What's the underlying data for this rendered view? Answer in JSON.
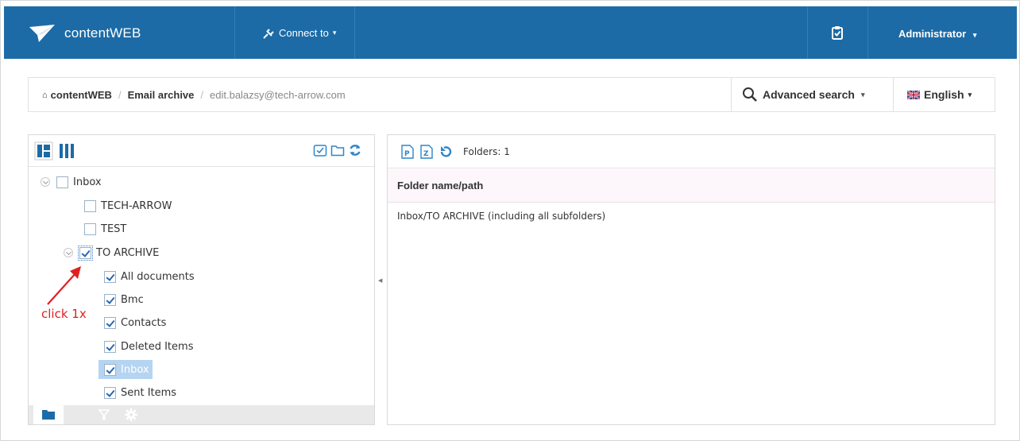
{
  "colors": {
    "navbar": "#1c6ba6",
    "accent": "#2767b0",
    "annotation": "#e02020",
    "selection": "#b5d4f2"
  },
  "navbar": {
    "brand": "contentWEB",
    "connect_label": "Connect to",
    "user_label": "Administrator",
    "icons": [
      "logo-icon",
      "plug-icon",
      "clipboard-check-icon"
    ]
  },
  "breadcrumb": {
    "items": [
      "contentWEB",
      "Email archive",
      "edit.balazsy@tech-arrow.com"
    ],
    "advanced_search": "Advanced search",
    "language": "English"
  },
  "tree": {
    "nodes": [
      {
        "label": "Inbox",
        "checked": false
      },
      {
        "label": "TECH-ARROW",
        "checked": false
      },
      {
        "label": "TEST",
        "checked": false
      },
      {
        "label": "TO ARCHIVE",
        "checked": true
      },
      {
        "label": "All documents",
        "checked": true
      },
      {
        "label": "Bmc",
        "checked": true
      },
      {
        "label": "Contacts",
        "checked": true
      },
      {
        "label": "Deleted Items",
        "checked": true
      },
      {
        "label": "Inbox",
        "checked": true,
        "selected": true
      },
      {
        "label": "Sent Items",
        "checked": true
      }
    ]
  },
  "annotation": "click 1x",
  "results": {
    "folders_count": "Folders: 1",
    "column_header": "Folder name/path",
    "rows": [
      "Inbox/TO ARCHIVE (including all subfolders)"
    ]
  }
}
